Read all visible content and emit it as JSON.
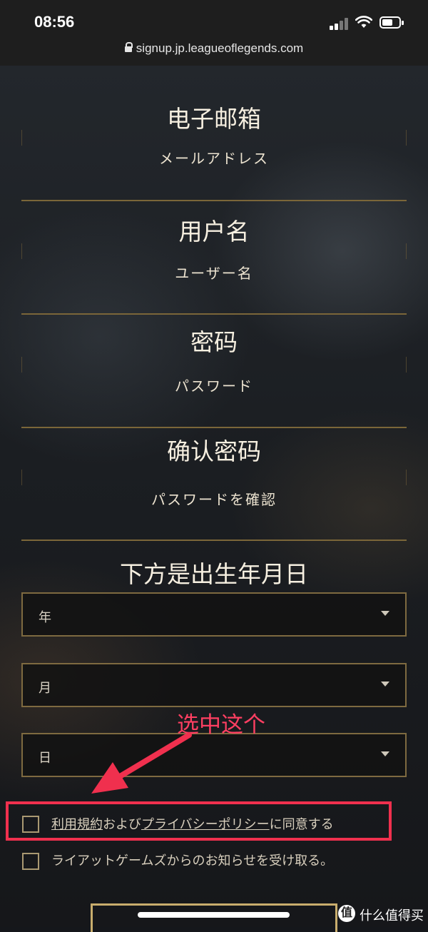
{
  "status_bar": {
    "time": "08:56"
  },
  "browser": {
    "url": "signup.jp.leagueoflegends.com"
  },
  "fields": [
    {
      "label": "电子邮箱",
      "placeholder": "メールアドレス"
    },
    {
      "label": "用户名",
      "placeholder": "ユーザー名"
    },
    {
      "label": "密码",
      "placeholder": "パスワード"
    },
    {
      "label": "确认密码",
      "placeholder": "パスワードを確認"
    }
  ],
  "birthday": {
    "heading": "下方是出生年月日",
    "year": "年",
    "month": "月",
    "day": "日"
  },
  "annotation": {
    "text": "选中这个",
    "color": "#ff3f62"
  },
  "consent": {
    "terms_link": "利用規約",
    "and": "および",
    "privacy_link": "プライバシーポリシー",
    "agree": "に同意する",
    "newsletter": "ライアットゲームズからのお知らせを受け取る。"
  },
  "watermark": {
    "logo": "值",
    "text": "什么值得买"
  },
  "colors": {
    "accent": "#c9ad6d",
    "annotation_red": "#f0304e"
  }
}
